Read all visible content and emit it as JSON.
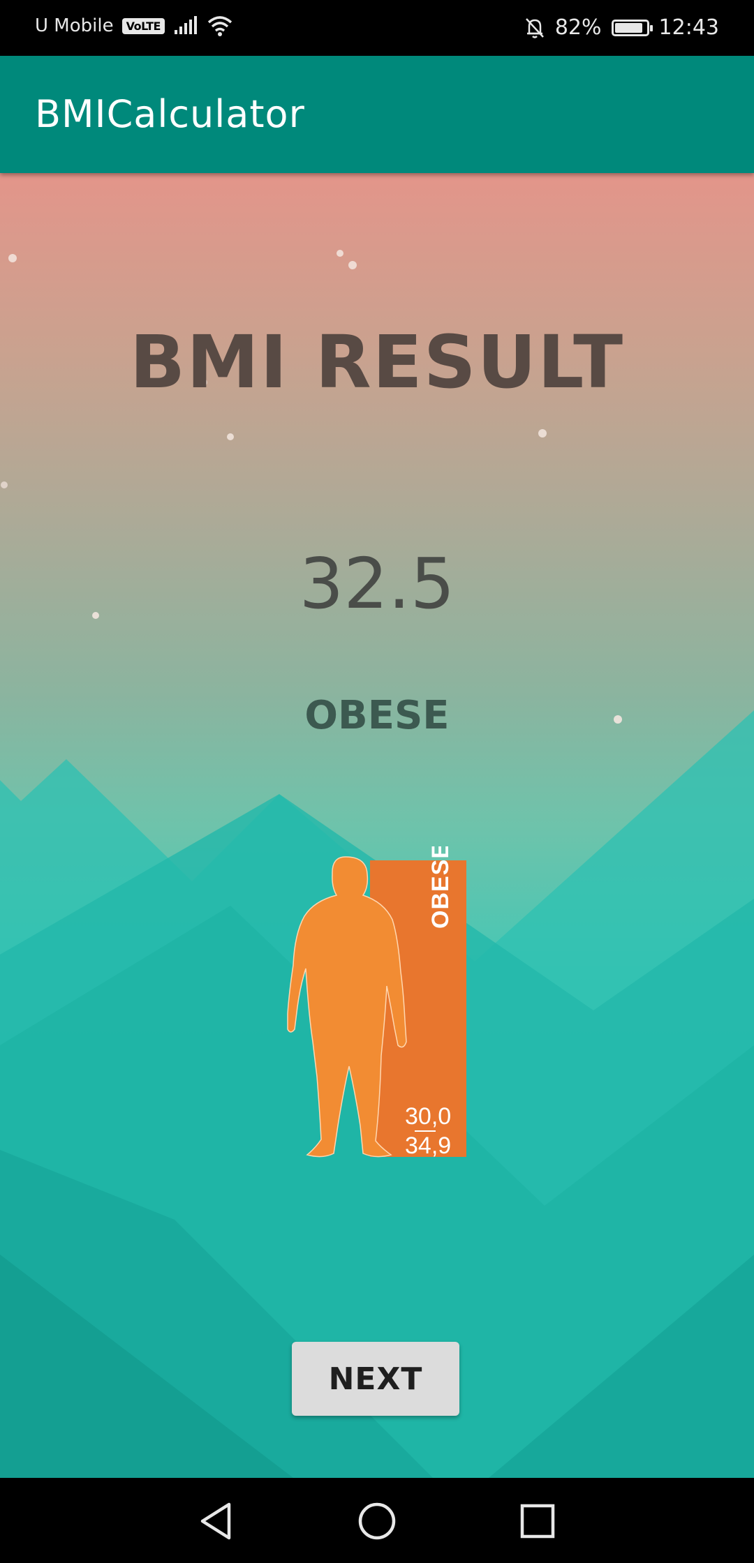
{
  "status_bar": {
    "carrier": "U Mobile",
    "network_badge": "VoLTE",
    "battery_percent": "82%",
    "battery_level": 0.82,
    "time": "12:43",
    "icons": [
      "signal-icon",
      "wifi-icon",
      "mute-bell-icon",
      "battery-icon"
    ]
  },
  "app_bar": {
    "title": "BMICalculator",
    "color": "#00897b"
  },
  "result": {
    "heading": "BMI RESULT",
    "bmi_value": "32.5",
    "category": "OBESE"
  },
  "illustration": {
    "label": "OBESE",
    "range_low": "30,0",
    "range_high": "34,9",
    "figure_color": "#f28c33",
    "panel_color": "#e8762e"
  },
  "actions": {
    "next_label": "NEXT"
  },
  "nav_bar": {
    "icons": [
      "back-icon",
      "home-icon",
      "recents-icon"
    ]
  }
}
